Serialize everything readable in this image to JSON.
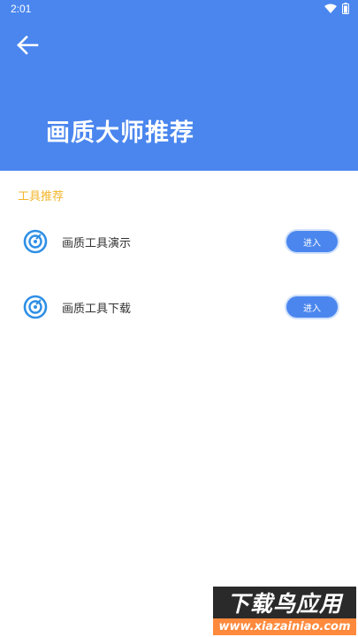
{
  "status_bar": {
    "time": "2:01"
  },
  "header": {
    "title": "画质大师推荐"
  },
  "section": {
    "title": "工具推荐"
  },
  "tools": [
    {
      "label": "画质工具演示",
      "button": "进入"
    },
    {
      "label": "画质工具下载",
      "button": "进入"
    }
  ],
  "watermark": {
    "title": "下载鸟应用",
    "url": "www.xiazainiao.com"
  },
  "colors": {
    "header_bg": "#4a86ee",
    "accent": "#f3b52b",
    "button_bg": "#4a86ee"
  }
}
